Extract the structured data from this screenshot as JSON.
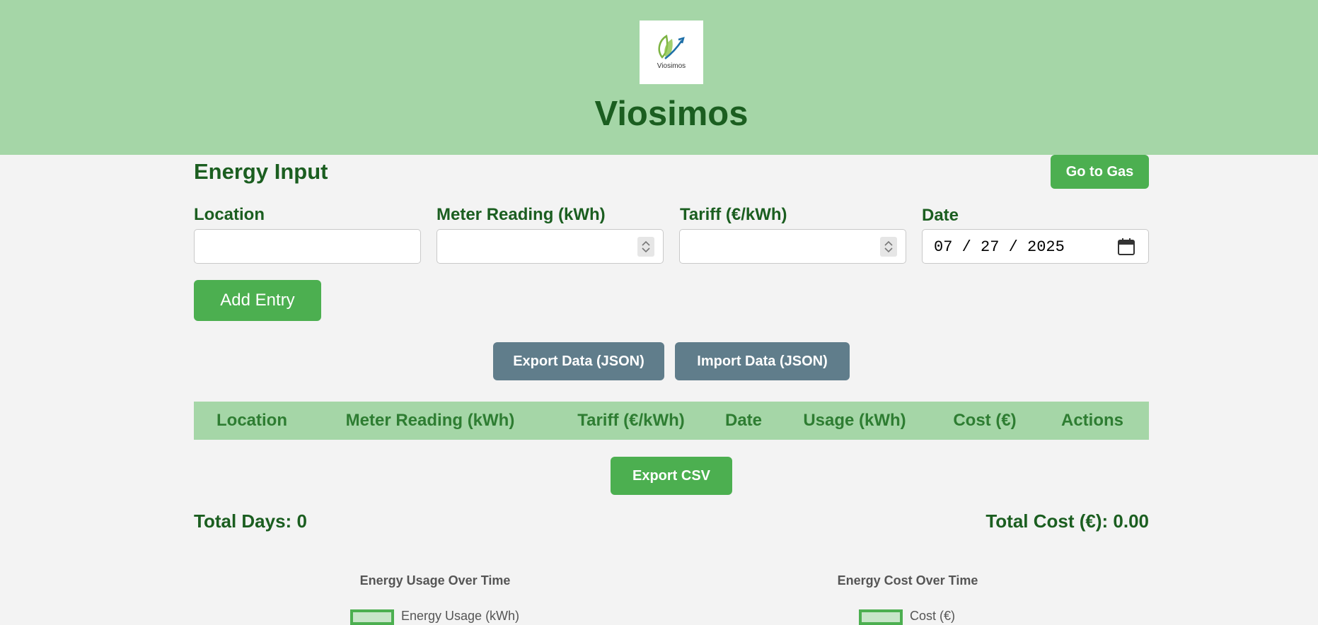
{
  "header": {
    "logo_text": "Viosimos",
    "title": "Viosimos"
  },
  "energy_input": {
    "section_title": "Energy Input",
    "go_to_gas_label": "Go to Gas",
    "fields": {
      "location_label": "Location",
      "location_value": "",
      "meter_label": "Meter Reading (kWh)",
      "meter_value": "",
      "tariff_label": "Tariff (€/kWh)",
      "tariff_value": "",
      "date_label": "Date",
      "date_value": "07 / 27 / 2025"
    },
    "add_entry_label": "Add Entry"
  },
  "data_actions": {
    "export_json_label": "Export Data (JSON)",
    "import_json_label": "Import Data (JSON)"
  },
  "table": {
    "headers": [
      "Location",
      "Meter Reading (kWh)",
      "Tariff (€/kWh)",
      "Date",
      "Usage (kWh)",
      "Cost (€)",
      "Actions"
    ],
    "rows": []
  },
  "export_csv_label": "Export CSV",
  "totals": {
    "days": "Total Days: 0",
    "cost": "Total Cost (€): 0.00"
  },
  "charts": {
    "usage_title": "Energy Usage Over Time",
    "usage_legend": "Energy Usage (kWh)",
    "cost_title": "Energy Cost Over Time",
    "cost_legend": "Cost (€)"
  },
  "colors": {
    "header_bg": "#a5d6a7",
    "primary_green": "#4caf50",
    "dark_green": "#1b5e20",
    "slate_button": "#607d8b",
    "page_bg": "#f3f3f3"
  },
  "icons": {
    "logo": "leaf-logo-icon",
    "spinner": "spinner-icon",
    "calendar": "calendar-icon"
  }
}
